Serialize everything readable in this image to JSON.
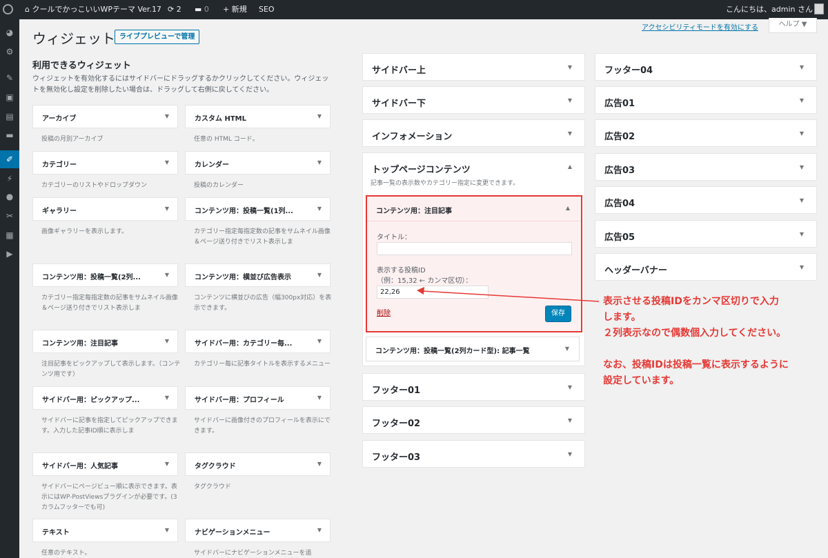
{
  "adminbar": {
    "site_name": "クールでかっこいいWPテーマ Ver.17",
    "updates_count": "2",
    "comments_count": "0",
    "new_label": "新規",
    "seo_label": "SEO",
    "howdy": "こんにちは、admin さん"
  },
  "screen_meta": {
    "a11y_link": "アクセシビリティモードを有効にする",
    "help_label": "ヘルプ ▼"
  },
  "page": {
    "title": "ウィジェット",
    "live_preview_button": "ライブプレビューで管理"
  },
  "available": {
    "title": "利用できるウィジェット",
    "description": "ウィジェットを有効化するにはサイドバーにドラッグするかクリックしてください。ウィジェットを無効化し設定を削除したい場合は、ドラッグして右側に戻してください。",
    "widgets": [
      {
        "name": "アーカイブ",
        "desc": "投稿の月別アーカイブ"
      },
      {
        "name": "カスタム HTML",
        "desc": "任意の HTML コード。"
      },
      {
        "name": "カテゴリー",
        "desc": "カテゴリーのリストやドロップダウン"
      },
      {
        "name": "カレンダー",
        "desc": "投稿のカレンダー"
      },
      {
        "name": "ギャラリー",
        "desc": "画像ギャラリーを表示します。"
      },
      {
        "name": "コンテンツ用：投稿一覧(1列...",
        "desc": "カテゴリー指定毎指定数の記事をサムネイル画像＆ページ送り付きでリスト表示しま"
      },
      {
        "name": "コンテンツ用：投稿一覧(2列...",
        "desc": "カテゴリー指定毎指定数の記事をサムネイル画像＆ページ送り付きでリスト表示しま"
      },
      {
        "name": "コンテンツ用：横並び広告表示",
        "desc": "コンテンツに横並びの広告（幅300px対応）を表示できます。"
      },
      {
        "name": "コンテンツ用：注目記事",
        "desc": "注目記事をピックアップして表示します。（コンテンツ用です）"
      },
      {
        "name": "サイドバー用：カテゴリー毎...",
        "desc": "カテゴリー毎に記事タイトルを表示するメニュー"
      },
      {
        "name": "サイドバー用：ピックアップ...",
        "desc": "サイドバーに記事を指定してピックアップできます。入力した記事ID順に表示しま"
      },
      {
        "name": "サイドバー用：プロフィール",
        "desc": "サイドバーに画像付きのプロフィールを表示にできます。"
      },
      {
        "name": "サイドバー用：人気記事",
        "desc": "サイドバーにページビュー順に表示できます。表示にはWP-PostViewsプラグインが必要です。(3カラムフッターでも可)"
      },
      {
        "name": "タグクラウド",
        "desc": "タグクラウド"
      },
      {
        "name": "テキスト",
        "desc": "任意のテキスト。"
      },
      {
        "name": "ナビゲーションメニュー",
        "desc": "サイドバーにナビゲーションメニューを追"
      }
    ]
  },
  "sidebars_col1": {
    "sidebar_top": "サイドバー上",
    "sidebar_bottom": "サイドバー下",
    "information": "インフォメーション",
    "top_contents": "トップページコンテンツ",
    "top_contents_desc": "記事一覧の表示数やカテゴリー指定に変更できます。",
    "second_widget": "コンテンツ用：投稿一覧(2列カード型): 記事一覧",
    "footer01": "フッター01",
    "footer02": "フッター02",
    "footer03": "フッター03"
  },
  "open_widget": {
    "title": "コンテンツ用：注目記事",
    "title_label": "タイトル：",
    "title_value": "",
    "ids_label_1": "表示する投稿ID",
    "ids_label_2": "（例：15,32 ← カンマ区切）：",
    "ids_value": "22,26",
    "delete_label": "削除",
    "save_label": "保存"
  },
  "sidebars_col2": {
    "footer04": "フッター04",
    "ad01": "広告01",
    "ad02": "広告02",
    "ad03": "広告03",
    "ad04": "広告04",
    "ad05": "広告05",
    "header_banner": "ヘッダーバナー"
  },
  "annotation": {
    "line1": "表示させる投稿IDをカンマ区切りで入力",
    "line2": "します。",
    "line3": "２列表示なので偶数個入力してください。",
    "line4": "なお、投稿IDは投稿一覧に表示するように",
    "line5": "設定しています。"
  },
  "colors": {
    "accent": "#0073aa",
    "annotation_red": "#e53935",
    "admin_dark": "#23282d"
  }
}
